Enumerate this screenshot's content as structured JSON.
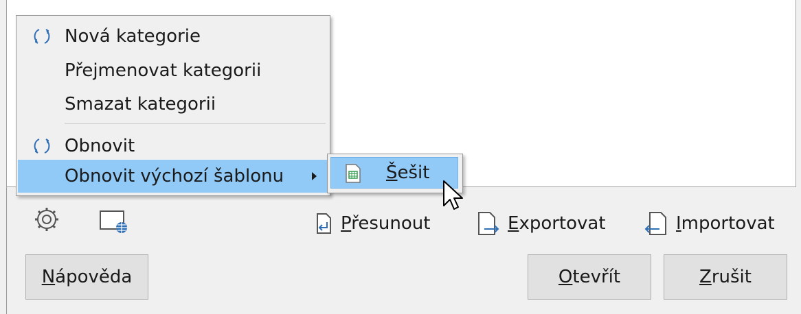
{
  "context_menu": {
    "items": [
      {
        "label": "Nová kategorie",
        "icon": "refresh-icon"
      },
      {
        "label": "Přejmenovat kategorii"
      },
      {
        "label": "Smazat kategorii"
      },
      {
        "label": "Obnovit",
        "icon": "refresh-icon"
      },
      {
        "label": "Obnovit výchozí šablonu",
        "has_submenu": true
      }
    ],
    "submenu": {
      "items": [
        {
          "label_accel": "Š",
          "label_rest": "ešit",
          "icon": "spreadsheet-icon"
        }
      ]
    }
  },
  "toolbar": {
    "settings_icon": "gear-icon",
    "online_icon": "globe-document-icon",
    "move": {
      "accel": "P",
      "rest": "řesunout"
    },
    "export": {
      "accel": "E",
      "rest": "xportovat"
    },
    "import": {
      "accel": "I",
      "rest": "mportovat"
    }
  },
  "buttons": {
    "help": {
      "accel": "N",
      "rest": "ápověda"
    },
    "open": {
      "accel": "O",
      "rest": "tevřít"
    },
    "cancel": {
      "accel": "Z",
      "rest": "rušit"
    }
  },
  "colors": {
    "highlight": "#91c9f7",
    "background": "#f0f0f0"
  }
}
